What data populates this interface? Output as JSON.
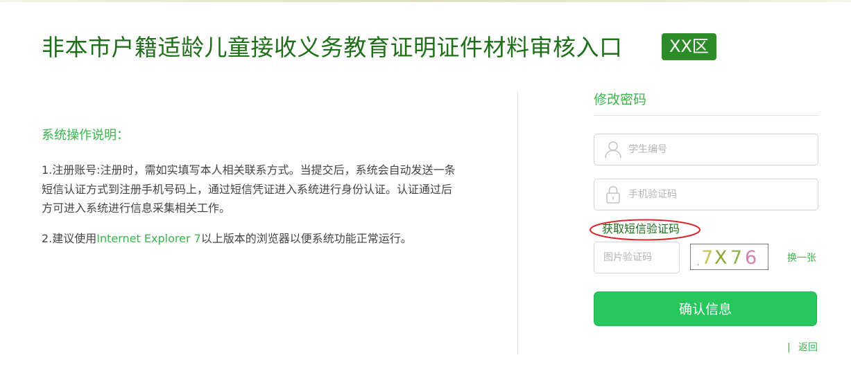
{
  "header": {
    "title": "非本市户籍适龄儿童接收义务教育证明证件材料审核入口",
    "district_badge": "XX区"
  },
  "instructions": {
    "title": "系统操作说明：",
    "item1": "1.注册账号:注册时，需如实填写本人相关联系方式。当提交后，系统会自动发送一条短信认证方式到注册手机号码上，通过短信凭证进入系统进行身份认证。认证通过后方可进入系统进行信息采集相关工作。",
    "item2_prefix": "2.建议使用",
    "item2_highlight": "Internet Explorer 7",
    "item2_suffix": "以上版本的浏览器以便系统功能正常运行。"
  },
  "form": {
    "title": "修改密码",
    "student_id": {
      "placeholder": "学生编号",
      "icon": "user-icon"
    },
    "sms_code": {
      "placeholder": "手机验证码",
      "icon": "lock-icon"
    },
    "get_sms_link": "获取短信验证码",
    "captcha": {
      "placeholder": "图片验证码",
      "image_text": ".7X76"
    },
    "refresh_link": "换一张",
    "confirm_button": "确认信息",
    "separator": "|",
    "back_link": "返回"
  },
  "colors": {
    "brand_dark_green": "#1f6e1a",
    "badge_green": "#2e8b2a",
    "accent_green": "#39b54a",
    "button_green": "#28c75d",
    "annotation_red": "#d9262e"
  }
}
